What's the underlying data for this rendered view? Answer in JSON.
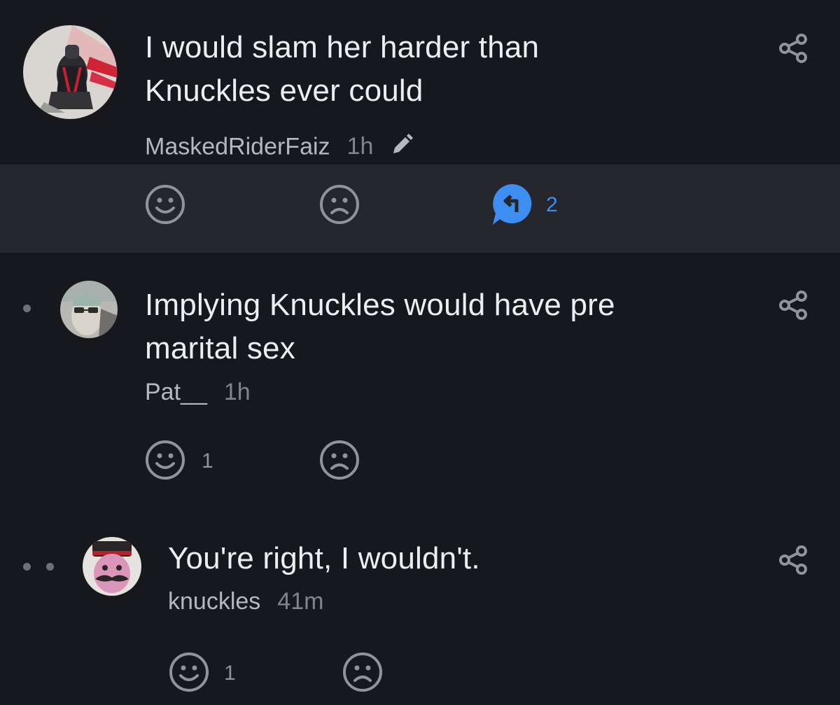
{
  "comments": [
    {
      "text": "I would slam her harder than Knuckles ever could",
      "user": "MaskedRiderFaiz",
      "time": "1h",
      "edited": true,
      "reply_count": "2",
      "avatar": "armored-rider-figure-avatar"
    },
    {
      "text": "Implying Knuckles would have pre marital sex",
      "user": "Pat__",
      "time": "1h",
      "like_count": "1",
      "avatar": "man-with-sunglasses-avatar"
    },
    {
      "text": "You're right, I wouldn't.",
      "user": "knuckles",
      "time": "41m",
      "like_count": "1",
      "avatar": "mustached-man-avatar"
    }
  ],
  "icons": {
    "like": "smiley-face-icon",
    "dislike": "frown-face-icon",
    "reply": "reply-bubble-icon",
    "share": "share-icon",
    "edit": "pencil-icon"
  },
  "colors": {
    "background": "#17181d",
    "action_bar": "#24262c",
    "accent_blue": "#3d8ef0",
    "muted_text": "#8f939b"
  }
}
